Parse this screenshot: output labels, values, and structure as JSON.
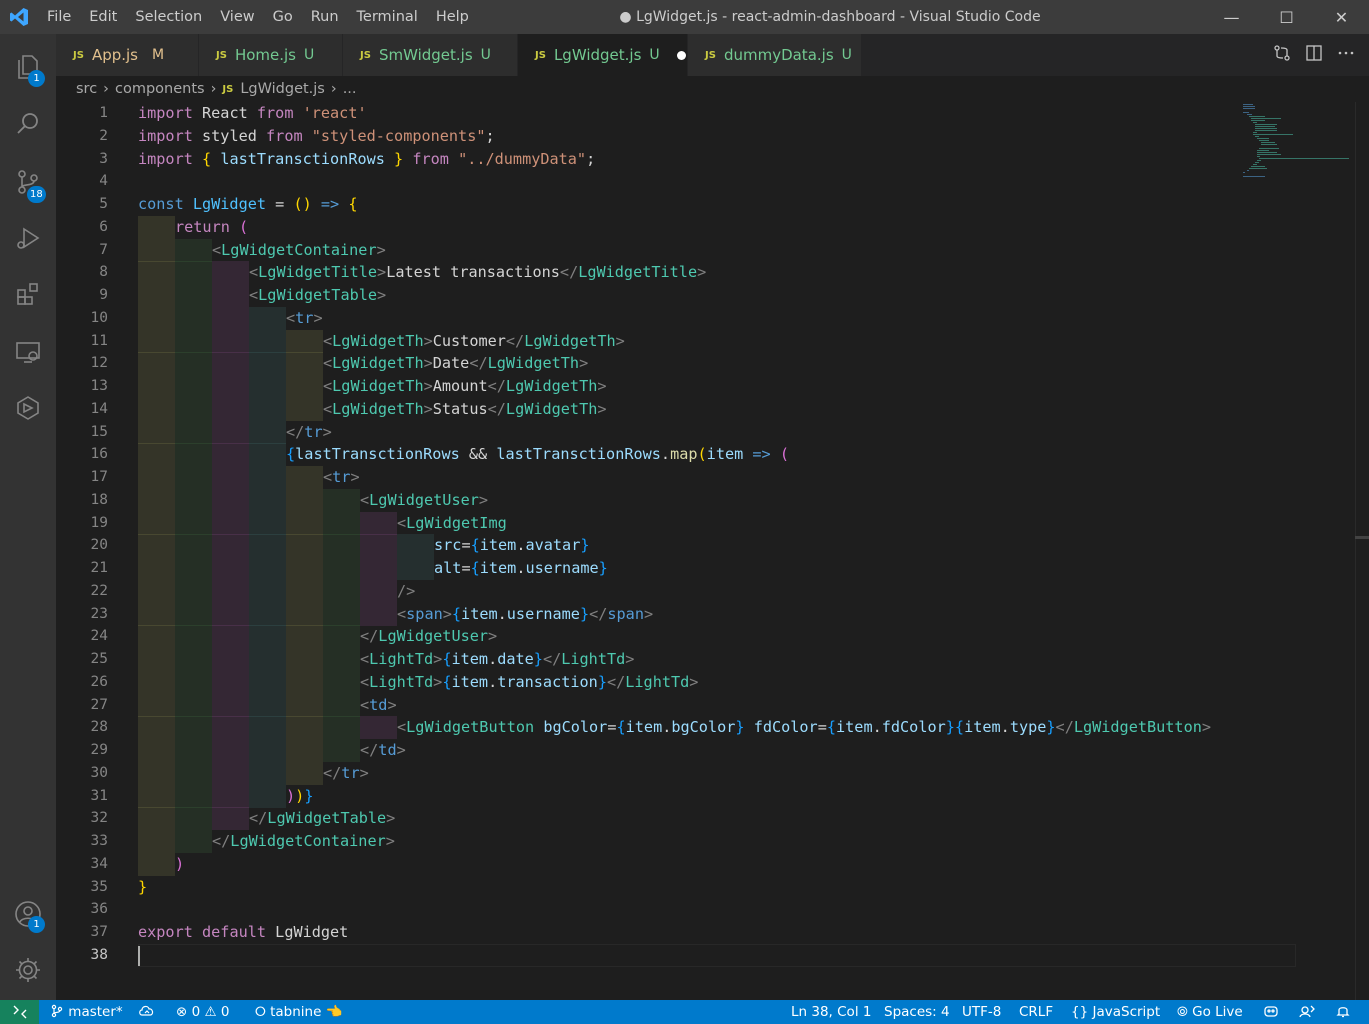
{
  "window": {
    "menu": [
      "File",
      "Edit",
      "Selection",
      "View",
      "Go",
      "Run",
      "Terminal",
      "Help"
    ],
    "title": "● LgWidget.js - react-admin-dashboard - Visual Studio Code",
    "minimize": "—",
    "maximize": "☐",
    "close": "✕"
  },
  "activity": {
    "explorer_badge": "1",
    "scm_badge": "18",
    "accounts_badge": "1"
  },
  "tabs": [
    {
      "label": "App.js",
      "status": "M"
    },
    {
      "label": "Home.js",
      "status": "U"
    },
    {
      "label": "SmWidget.js",
      "status": "U"
    },
    {
      "label": "LgWidget.js",
      "status": "U"
    },
    {
      "label": "dummyData.js",
      "status": "U"
    }
  ],
  "tab_icon_text": "JS",
  "breadcrumb": {
    "parts": [
      "src",
      "components"
    ],
    "file": "LgWidget.js",
    "more": "..."
  },
  "editor": {
    "line_numbers": [
      "1",
      "2",
      "3",
      "4",
      "5",
      "6",
      "7",
      "8",
      "9",
      "10",
      "11",
      "12",
      "13",
      "14",
      "15",
      "16",
      "17",
      "18",
      "19",
      "20",
      "21",
      "22",
      "23",
      "24",
      "25",
      "26",
      "27",
      "28",
      "29",
      "30",
      "31",
      "32",
      "33",
      "34",
      "35",
      "36",
      "37",
      "38"
    ],
    "code": {
      "l1": [
        "import",
        " React ",
        "from",
        " 'react'"
      ],
      "l2": [
        "import",
        " styled ",
        "from",
        " \"styled-components\"",
        ";"
      ],
      "l3": [
        "import",
        " { ",
        "lastTransctionRows",
        " } ",
        "from",
        " \"../dummyData\"",
        ";"
      ],
      "l5": [
        "const",
        " LgWidget",
        " = ",
        "()",
        " => ",
        "{"
      ],
      "l6": [
        "return",
        " ("
      ],
      "l7": [
        "<",
        "LgWidgetContainer",
        ">"
      ],
      "l8": [
        "<",
        "LgWidgetTitle",
        ">",
        "Latest transactions",
        "</",
        "LgWidgetTitle",
        ">"
      ],
      "l9": [
        "<",
        "LgWidgetTable",
        ">"
      ],
      "l10": [
        "<",
        "tr",
        ">"
      ],
      "l11": [
        "<",
        "LgWidgetTh",
        ">",
        "Customer",
        "</",
        "LgWidgetTh",
        ">"
      ],
      "l12": [
        "<",
        "LgWidgetTh",
        ">",
        "Date",
        "</",
        "LgWidgetTh",
        ">"
      ],
      "l13": [
        "<",
        "LgWidgetTh",
        ">",
        "Amount",
        "</",
        "LgWidgetTh",
        ">"
      ],
      "l14": [
        "<",
        "LgWidgetTh",
        ">",
        "Status",
        "</",
        "LgWidgetTh",
        ">"
      ],
      "l15": [
        "</",
        "tr",
        ">"
      ],
      "l16": [
        "{",
        "lastTransctionRows",
        " && ",
        "lastTransctionRows",
        ".",
        "map",
        "(",
        "item",
        " => ",
        "("
      ],
      "l17": [
        "<",
        "tr",
        ">"
      ],
      "l18": [
        "<",
        "LgWidgetUser",
        ">"
      ],
      "l19": [
        "<",
        "LgWidgetImg"
      ],
      "l20": [
        "src",
        "=",
        "{",
        "item",
        ".",
        "avatar",
        "}"
      ],
      "l21": [
        "alt",
        "=",
        "{",
        "item",
        ".",
        "username",
        "}"
      ],
      "l22": [
        "/>"
      ],
      "l23": [
        "<",
        "span",
        ">",
        "{",
        "item",
        ".",
        "username",
        "}",
        "</",
        "span",
        ">"
      ],
      "l24": [
        "</",
        "LgWidgetUser",
        ">"
      ],
      "l25": [
        "<",
        "LightTd",
        ">",
        "{",
        "item",
        ".",
        "date",
        "}",
        "</",
        "LightTd",
        ">"
      ],
      "l26": [
        "<",
        "LightTd",
        ">",
        "{",
        "item",
        ".",
        "transaction",
        "}",
        "</",
        "LightTd",
        ">"
      ],
      "l27": [
        "<",
        "td",
        ">"
      ],
      "l28": [
        "<",
        "LgWidgetButton",
        " bgColor",
        "=",
        "{",
        "item",
        ".",
        "bgColor",
        "}",
        " fdColor",
        "=",
        "{",
        "item",
        ".",
        "fdColor",
        "}",
        "{",
        "item",
        ".",
        "type",
        "}",
        "</",
        "LgWidgetButton",
        ">"
      ],
      "l29": [
        "</",
        "td",
        ">"
      ],
      "l30": [
        "</",
        "tr",
        ">"
      ],
      "l31": [
        ")",
        ")",
        "}"
      ],
      "l32": [
        "</",
        "LgWidgetTable",
        ">"
      ],
      "l33": [
        "</",
        "LgWidgetContainer",
        ">"
      ],
      "l34": [
        ")"
      ],
      "l35": [
        "}"
      ],
      "l37": [
        "export",
        " default",
        " LgWidget"
      ]
    }
  },
  "statusbar": {
    "branch": "master*",
    "errors": "0",
    "warnings": "0",
    "tabnine": "tabnine",
    "position": "Ln 38, Col 1",
    "spaces": "Spaces: 4",
    "encoding": "UTF-8",
    "eol": "CRLF",
    "language": "JavaScript",
    "golive": "Go Live"
  },
  "colors": {
    "accent": "#007acc",
    "remote": "#16825d",
    "editor_bg": "#1e1e1e"
  }
}
